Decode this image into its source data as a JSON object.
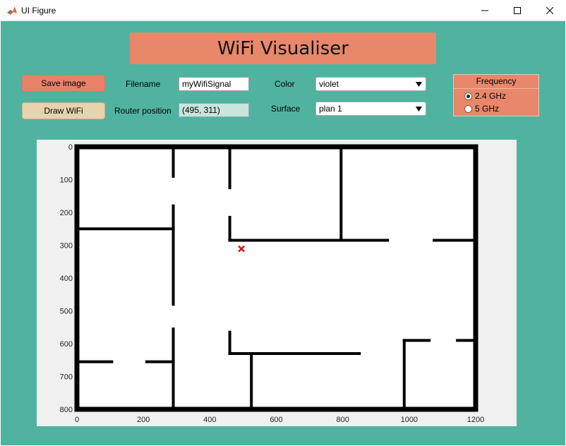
{
  "window": {
    "title": "UI Figure"
  },
  "banner": {
    "title": "WiFi Visualiser"
  },
  "buttons": {
    "save_label": "Save image",
    "draw_label": "Draw WiFi"
  },
  "filename": {
    "label": "Filename",
    "value": "myWifiSignal"
  },
  "router": {
    "label": "Router position",
    "value": "(495, 311)",
    "x": 495,
    "y": 311,
    "marker_color": "#e01010"
  },
  "color": {
    "label": "Color",
    "selected": "violet"
  },
  "surface": {
    "label": "Surface",
    "selected": "plan 1"
  },
  "frequency": {
    "title": "Frequency",
    "options": [
      {
        "label": "2.4 GHz",
        "selected": true
      },
      {
        "label": "5 GHz",
        "selected": false
      }
    ]
  },
  "colors": {
    "background": "#4fb3a0",
    "banner": "#e8876a",
    "save_button": "#e8826a",
    "draw_button": "#e8d3ae",
    "readonly_field": "#c8e6dc",
    "walls": "#000000"
  },
  "axes": {
    "x_ticks": [
      "0",
      "200",
      "400",
      "600",
      "800",
      "1000",
      "1200"
    ],
    "y_ticks": [
      "0",
      "100",
      "200",
      "300",
      "400",
      "500",
      "600",
      "700",
      "800"
    ],
    "xlim": [
      0,
      1200
    ],
    "ylim": [
      0,
      800
    ],
    "y_reversed": true
  },
  "floor_plan": {
    "walls": [
      [
        [
          0,
          0
        ],
        [
          1200,
          0
        ]
      ],
      [
        [
          1200,
          0
        ],
        [
          1200,
          800
        ]
      ],
      [
        [
          1200,
          800
        ],
        [
          0,
          800
        ]
      ],
      [
        [
          0,
          800
        ],
        [
          0,
          0
        ]
      ],
      [
        [
          290,
          0
        ],
        [
          290,
          90
        ]
      ],
      [
        [
          290,
          180
        ],
        [
          290,
          480
        ]
      ],
      [
        [
          290,
          555
        ],
        [
          290,
          800
        ]
      ],
      [
        [
          0,
          250
        ],
        [
          290,
          250
        ]
      ],
      [
        [
          460,
          0
        ],
        [
          460,
          125
        ]
      ],
      [
        [
          460,
          215
        ],
        [
          460,
          285
        ]
      ],
      [
        [
          460,
          285
        ],
        [
          935,
          285
        ]
      ],
      [
        [
          1075,
          285
        ],
        [
          1200,
          285
        ]
      ],
      [
        [
          795,
          0
        ],
        [
          795,
          285
        ]
      ],
      [
        [
          460,
          565
        ],
        [
          460,
          630
        ]
      ],
      [
        [
          460,
          630
        ],
        [
          850,
          630
        ]
      ],
      [
        [
          525,
          630
        ],
        [
          525,
          800
        ]
      ],
      [
        [
          0,
          655
        ],
        [
          105,
          655
        ]
      ],
      [
        [
          210,
          655
        ],
        [
          290,
          655
        ]
      ],
      [
        [
          985,
          590
        ],
        [
          985,
          800
        ]
      ],
      [
        [
          985,
          590
        ],
        [
          1060,
          590
        ]
      ],
      [
        [
          1145,
          590
        ],
        [
          1200,
          590
        ]
      ]
    ]
  }
}
